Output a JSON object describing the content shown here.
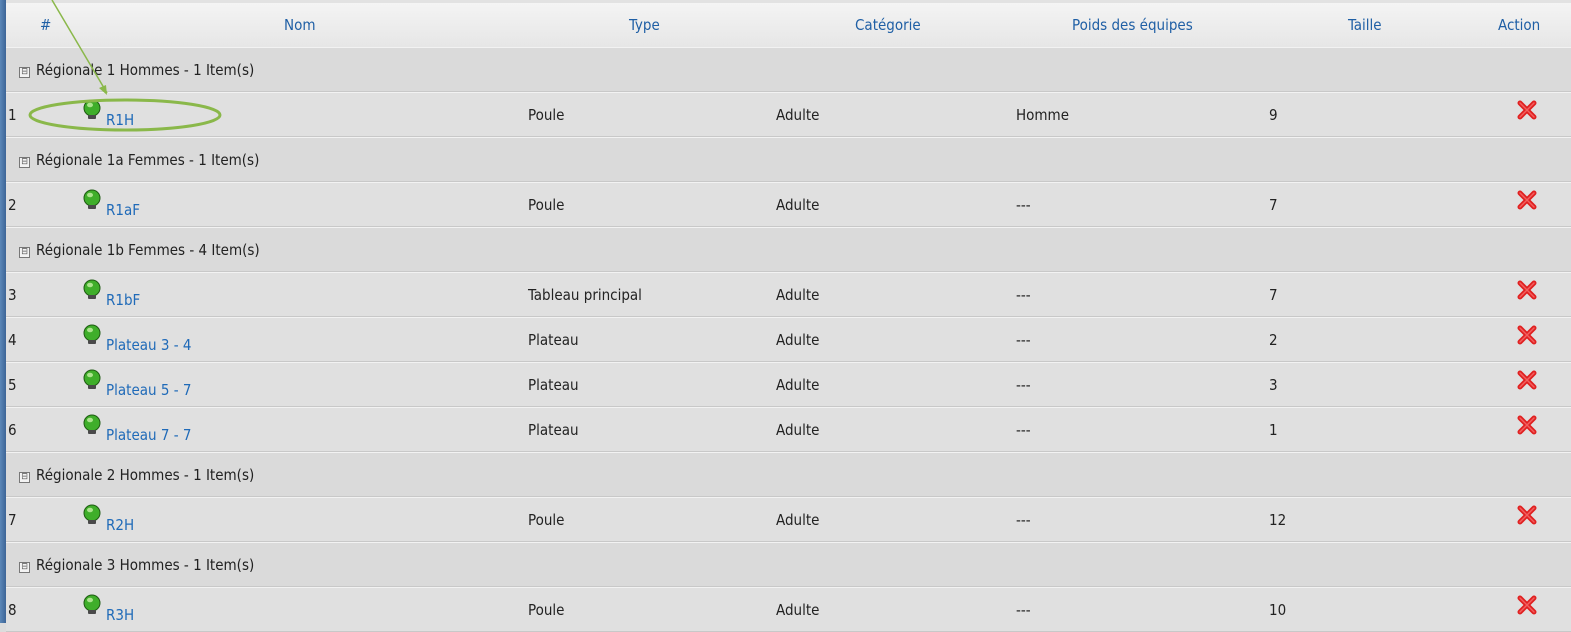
{
  "columns": {
    "hash": "#",
    "nom": "Nom",
    "type": "Type",
    "categorie": "Catégorie",
    "poids": "Poids des équipes",
    "taille": "Taille",
    "action": "Action"
  },
  "groups": [
    {
      "label": "Régionale 1 Hommes - 1 Item(s)",
      "rows": [
        {
          "idx": "1",
          "nom": "R1H",
          "type": "Poule",
          "categorie": "Adulte",
          "poids": "Homme",
          "taille": "9"
        }
      ]
    },
    {
      "label": "Régionale 1a Femmes - 1 Item(s)",
      "rows": [
        {
          "idx": "2",
          "nom": "R1aF",
          "type": "Poule",
          "categorie": "Adulte",
          "poids": "---",
          "taille": "7"
        }
      ]
    },
    {
      "label": "Régionale 1b Femmes - 4 Item(s)",
      "rows": [
        {
          "idx": "3",
          "nom": "R1bF",
          "type": "Tableau principal",
          "categorie": "Adulte",
          "poids": "---",
          "taille": "7"
        },
        {
          "idx": "4",
          "nom": "Plateau 3 - 4",
          "type": "Plateau",
          "categorie": "Adulte",
          "poids": "---",
          "taille": "2"
        },
        {
          "idx": "5",
          "nom": "Plateau 5 - 7",
          "type": "Plateau",
          "categorie": "Adulte",
          "poids": "---",
          "taille": "3"
        },
        {
          "idx": "6",
          "nom": "Plateau 7 - 7",
          "type": "Plateau",
          "categorie": "Adulte",
          "poids": "---",
          "taille": "1"
        }
      ]
    },
    {
      "label": "Régionale 2 Hommes - 1 Item(s)",
      "rows": [
        {
          "idx": "7",
          "nom": "R2H",
          "type": "Poule",
          "categorie": "Adulte",
          "poids": "---",
          "taille": "12"
        }
      ]
    },
    {
      "label": "Régionale 3 Hommes - 1 Item(s)",
      "rows": [
        {
          "idx": "8",
          "nom": "R3H",
          "type": "Poule",
          "categorie": "Adulte",
          "poids": "---",
          "taille": "10"
        }
      ]
    }
  ],
  "colors": {
    "link": "#1f6ab8",
    "header_text": "#1f5fa5",
    "delete": "#e02020",
    "status_green": "#3fae2a",
    "annotation": "#8ab84a"
  },
  "icons": {
    "expander": "collapse-icon",
    "status": "green-status-icon",
    "delete": "delete-icon"
  }
}
